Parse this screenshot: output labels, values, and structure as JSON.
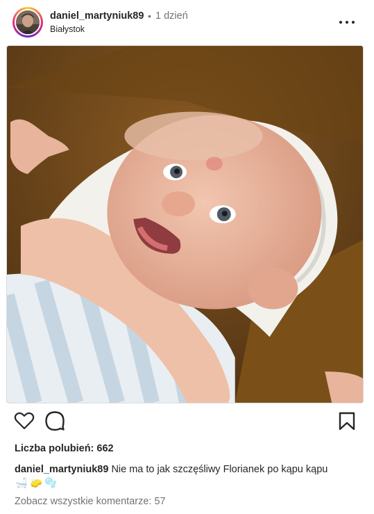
{
  "post": {
    "username": "daniel_martyniuk89",
    "separator": "•",
    "time_ago": "1 dzień",
    "location": "Białystok",
    "more_icon": "more-horizontal-icon"
  },
  "photo": {
    "icon": "post-photo"
  },
  "actions": {
    "like_icon": "heart-icon",
    "comment_icon": "comment-icon",
    "save_icon": "bookmark-icon"
  },
  "likes": {
    "text": "Liczba polubień: 662"
  },
  "caption": {
    "username": "daniel_martyniuk89",
    "text": "Nie ma to jak szczęśliwy Florianek po kąpu kąpu",
    "emojis": [
      "🛁",
      "🧽",
      "🫧"
    ]
  },
  "comments": {
    "view_all": "Zobacz wszystkie komentarze: 57"
  },
  "colors": {
    "text": "#262626",
    "muted": "#737373",
    "story_ring": [
      "#f9ce34",
      "#ee2a7b",
      "#6228d7"
    ]
  }
}
